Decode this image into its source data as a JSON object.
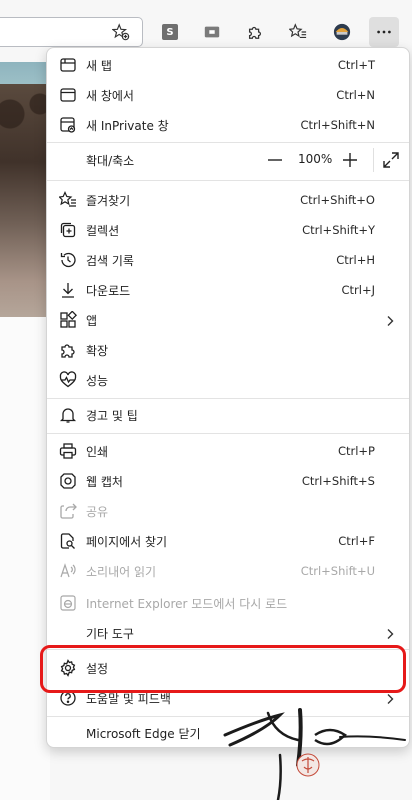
{
  "menu": {
    "new_tab": {
      "label": "새 탭",
      "shortcut": "Ctrl+T"
    },
    "new_window": {
      "label": "새 창에서",
      "shortcut": "Ctrl+N"
    },
    "new_inprivate": {
      "label": "새 InPrivate 창",
      "shortcut": "Ctrl+Shift+N"
    },
    "zoom": {
      "label": "확대/축소",
      "value": "100%"
    },
    "favorites": {
      "label": "즐겨찾기",
      "shortcut": "Ctrl+Shift+O"
    },
    "collections": {
      "label": "컬렉션",
      "shortcut": "Ctrl+Shift+Y"
    },
    "history": {
      "label": "검색 기록",
      "shortcut": "Ctrl+H"
    },
    "downloads": {
      "label": "다운로드",
      "shortcut": "Ctrl+J"
    },
    "apps": {
      "label": "앱"
    },
    "extensions": {
      "label": "확장"
    },
    "performance": {
      "label": "성능"
    },
    "alerts_tips": {
      "label": "경고 및 팁"
    },
    "print": {
      "label": "인쇄",
      "shortcut": "Ctrl+P"
    },
    "web_capture": {
      "label": "웹 캡처",
      "shortcut": "Ctrl+Shift+S"
    },
    "share": {
      "label": "공유"
    },
    "find_on_page": {
      "label": "페이지에서 찾기",
      "shortcut": "Ctrl+F"
    },
    "read_aloud": {
      "label": "소리내어 읽기",
      "shortcut": "Ctrl+Shift+U"
    },
    "ie_mode": {
      "label": "Internet Explorer 모드에서 다시 로드"
    },
    "more_tools": {
      "label": "기타 도구"
    },
    "settings": {
      "label": "설정"
    },
    "help_feedback": {
      "label": "도움말 및 피드백"
    },
    "close_edge": {
      "label": "Microsoft Edge 닫기"
    }
  },
  "toolbar": {
    "s_badge": "S"
  },
  "colors": {
    "highlight": "#e61919",
    "disabled_text": "#a8a8a8"
  }
}
